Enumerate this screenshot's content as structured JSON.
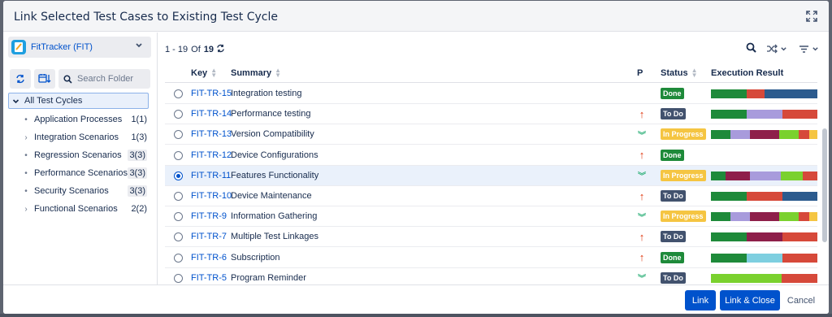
{
  "dialog": {
    "title": "Link Selected Test Cases to Existing Test Cycle",
    "expand_icon": "expand-icon"
  },
  "sidebar": {
    "project_name": "FitTracker (FIT)",
    "search_placeholder": "Search Folder",
    "root_label": "All Test Cycles",
    "items": [
      {
        "label": "Application Processes",
        "count": "1(1)",
        "marker": "dot"
      },
      {
        "label": "Integration Scenarios",
        "count": "1(3)",
        "marker": "chevron"
      },
      {
        "label": "Regression Scenarios",
        "count": "3(3)",
        "marker": "dot"
      },
      {
        "label": "Performance Scenarios",
        "count": "3(3)",
        "marker": "dot"
      },
      {
        "label": "Security Scenarios",
        "count": "3(3)",
        "marker": "dot"
      },
      {
        "label": "Functional Scenarios",
        "count": "2(2)",
        "marker": "chevron"
      }
    ]
  },
  "pager": {
    "range": "1 - 19",
    "of_label": "Of",
    "total": "19"
  },
  "table": {
    "headers": {
      "key": "Key",
      "summary": "Summary",
      "priority": "P",
      "status": "Status",
      "execution": "Execution Result"
    },
    "rows": [
      {
        "key": "FIT-TR-15",
        "summary": "Integration testing",
        "priority": "",
        "status": "Done",
        "selected": false,
        "exec": [
          [
            "#1e8a3a",
            0.33
          ],
          [
            "#d6493a",
            0.17
          ],
          [
            "#2c5b8e",
            0.5
          ]
        ]
      },
      {
        "key": "FIT-TR-14",
        "summary": "Performance testing",
        "priority": "up",
        "status": "To Do",
        "selected": false,
        "exec": [
          [
            "#1e8a3a",
            0.33
          ],
          [
            "#a89bdc",
            0.34
          ],
          [
            "#d6493a",
            0.33
          ]
        ]
      },
      {
        "key": "FIT-TR-13",
        "summary": "Version Compatibility",
        "priority": "down",
        "status": "In Progress",
        "selected": false,
        "exec": [
          [
            "#1e8a3a",
            0.18
          ],
          [
            "#a89bdc",
            0.18
          ],
          [
            "#8e1f4a",
            0.28
          ],
          [
            "#7ad12e",
            0.18
          ],
          [
            "#d6493a",
            0.1
          ],
          [
            "#f5c542",
            0.08
          ]
        ]
      },
      {
        "key": "FIT-TR-12",
        "summary": "Device Configurations",
        "priority": "up",
        "status": "Done",
        "selected": false,
        "exec": []
      },
      {
        "key": "FIT-TR-11",
        "summary": "Features Functionality",
        "priority": "down",
        "status": "In Progress",
        "selected": true,
        "exec": [
          [
            "#1e8a3a",
            0.14
          ],
          [
            "#8e1f4a",
            0.22
          ],
          [
            "#a89bdc",
            0.29
          ],
          [
            "#7ad12e",
            0.21
          ],
          [
            "#d6493a",
            0.14
          ]
        ]
      },
      {
        "key": "FIT-TR-10",
        "summary": "Device Maintenance",
        "priority": "up",
        "status": "To Do",
        "selected": false,
        "exec": [
          [
            "#1e8a3a",
            0.33
          ],
          [
            "#d6493a",
            0.34
          ],
          [
            "#2c5b8e",
            0.33
          ]
        ]
      },
      {
        "key": "FIT-TR-9",
        "summary": "Information Gathering",
        "priority": "down",
        "status": "In Progress",
        "selected": false,
        "exec": [
          [
            "#1e8a3a",
            0.18
          ],
          [
            "#a89bdc",
            0.18
          ],
          [
            "#8e1f4a",
            0.28
          ],
          [
            "#7ad12e",
            0.18
          ],
          [
            "#d6493a",
            0.1
          ],
          [
            "#f5c542",
            0.08
          ]
        ]
      },
      {
        "key": "FIT-TR-7",
        "summary": "Multiple Test Linkages",
        "priority": "up",
        "status": "To Do",
        "selected": false,
        "exec": [
          [
            "#1e8a3a",
            0.33
          ],
          [
            "#8e1f4a",
            0.34
          ],
          [
            "#d6493a",
            0.33
          ]
        ]
      },
      {
        "key": "FIT-TR-6",
        "summary": "Subscription",
        "priority": "up",
        "status": "Done",
        "selected": false,
        "exec": [
          [
            "#1e8a3a",
            0.33
          ],
          [
            "#7ecfe0",
            0.34
          ],
          [
            "#d6493a",
            0.33
          ]
        ]
      },
      {
        "key": "FIT-TR-5",
        "summary": "Program Reminder",
        "priority": "down",
        "status": "To Do",
        "selected": false,
        "exec": [
          [
            "#7ad12e",
            0.66
          ],
          [
            "#d6493a",
            0.34
          ]
        ]
      }
    ]
  },
  "status_colors": {
    "Done": "#1e8a3a",
    "To Do": "#42526e",
    "In Progress": "#f5c542"
  },
  "footer": {
    "link_label": "Link",
    "link_close_label": "Link & Close",
    "cancel_label": "Cancel"
  }
}
